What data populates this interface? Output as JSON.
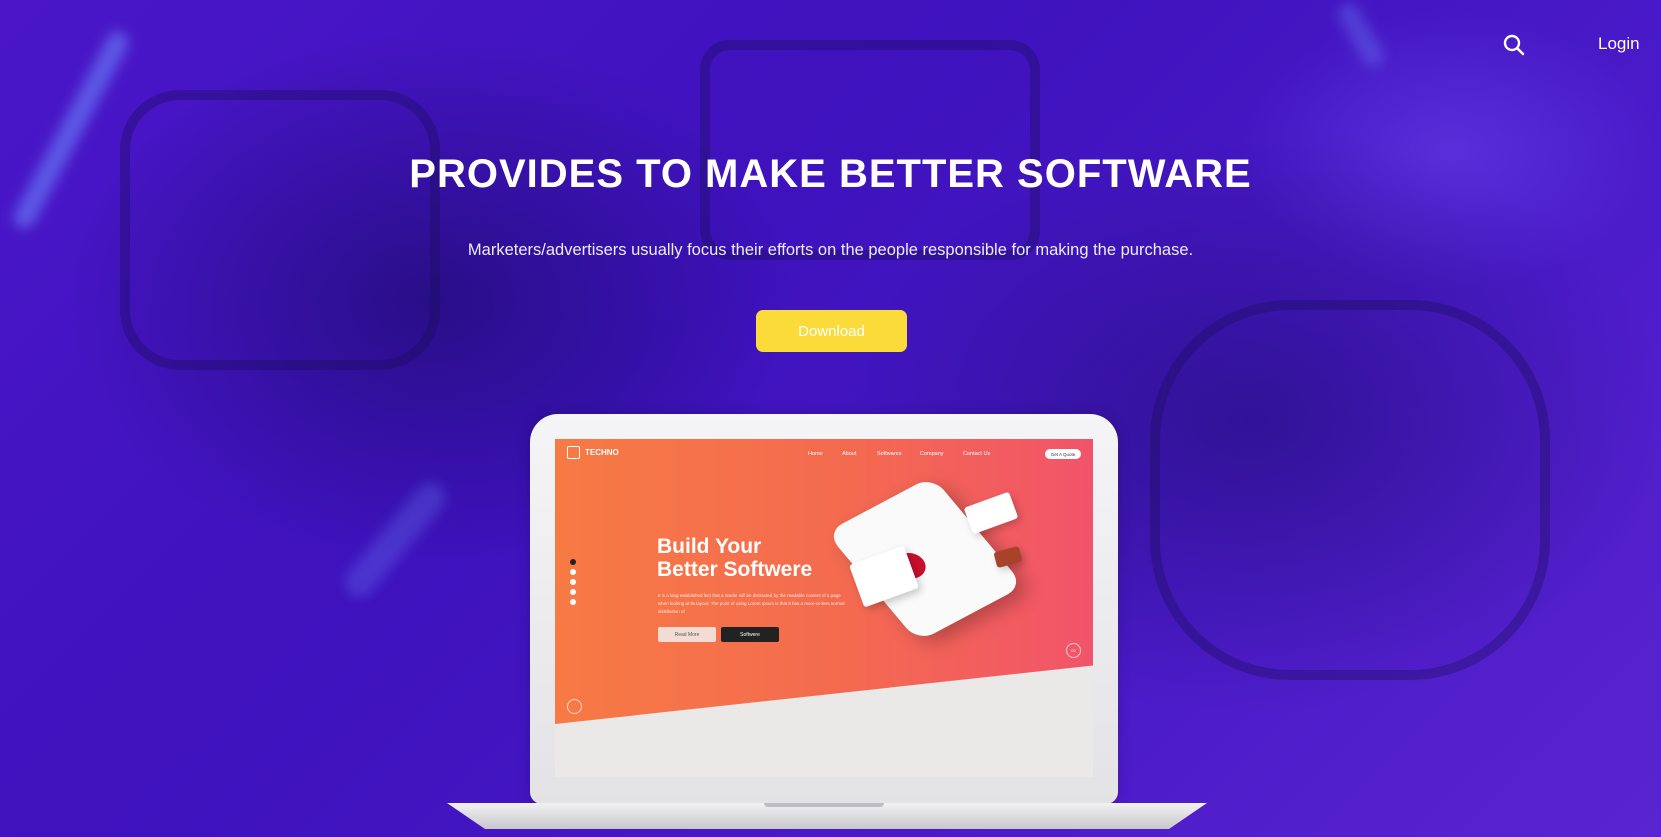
{
  "topbar": {
    "login_label": "Login"
  },
  "hero": {
    "headline": "PROVIDES TO MAKE BETTER SOFTWARE",
    "subline": "Marketers/advertisers usually focus their efforts on the people responsible for making the purchase.",
    "download_label": "Download"
  },
  "mockup": {
    "logo_text": "TECHNO",
    "nav": [
      "Home",
      "About",
      "Softwares",
      "Company",
      "Contact Us"
    ],
    "quote_button": "Get A Quote",
    "title_line1": "Build Your",
    "title_line2": "Better Softwere",
    "paragraph": "It is a long established fact that a reader will be distracted by the readable content of a page when looking at its layout. The point of using Lorem Ipsum is that it has a more-or-less normal distribution of",
    "read_more": "Read More",
    "softwere": "Softwere",
    "slide_counter": "02"
  },
  "colors": {
    "accent_button": "#fbdb3a",
    "background": "#3a10c0",
    "mockup_gradient_start": "#f77a44",
    "mockup_gradient_end": "#f1546a"
  }
}
